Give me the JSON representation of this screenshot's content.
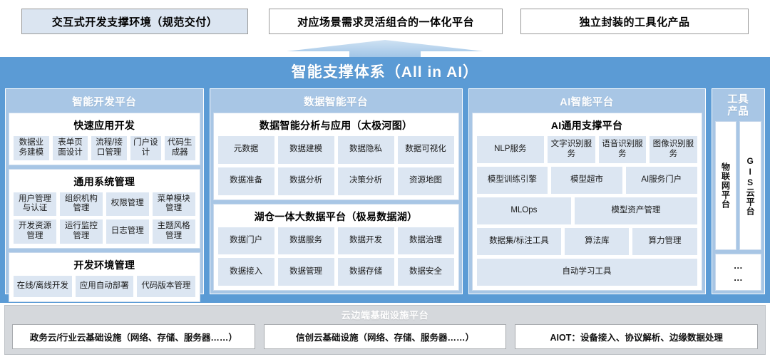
{
  "top_boxes": [
    {
      "label": "交互式开发支撑环境（规范交付）",
      "tinted": true
    },
    {
      "label": "对应场景需求灵活组合的一体化平台",
      "tinted": false
    },
    {
      "label": "独立封装的工具化产品",
      "tinted": false
    }
  ],
  "arrow": {
    "name": "up-arrow-connector",
    "color": "#a8cbe8"
  },
  "main": {
    "title": "智能支撑体系（All in AI）",
    "background_color": "#5b9bd5",
    "panels": [
      {
        "id": "dev",
        "title": "智能开发平台",
        "groups": [
          {
            "title": "快速应用开发",
            "rows": [
              [
                "数据业务建模",
                "表单页面设计",
                "流程/接口管理",
                "门户设计",
                "代码生成器"
              ]
            ]
          },
          {
            "title": "通用系统管理",
            "rows": [
              [
                "用户管理与认证",
                "组织机构管理",
                "权限管理",
                "菜单模块管理"
              ],
              [
                "开发资源管理",
                "运行监控管理",
                "日志管理",
                "主题风格管理"
              ]
            ]
          },
          {
            "title": "开发环境管理",
            "rows": [
              [
                "在线/离线开发",
                "应用自动部署",
                "代码版本管理"
              ]
            ]
          }
        ]
      },
      {
        "id": "data",
        "title": "数据智能平台",
        "groups": [
          {
            "title": "数据智能分析与应用（太极河图）",
            "rows": [
              [
                "元数据",
                "数据建模",
                "数据隐私",
                "数据可视化"
              ],
              [
                "数据准备",
                "数据分析",
                "决策分析",
                "资源地图"
              ]
            ]
          },
          {
            "title": "湖仓一体大数据平台（极易数据湖）",
            "rows": [
              [
                "数据门户",
                "数据服务",
                "数据开发",
                "数据治理"
              ],
              [
                "数据接入",
                "数据管理",
                "数据存储",
                "数据安全"
              ]
            ]
          }
        ]
      },
      {
        "id": "ai",
        "title": "AI智能平台",
        "groups": [
          {
            "title": "AI通用支撑平台",
            "rows": [
              [
                "NLP服务",
                "文字识别服务",
                "语音识别服务",
                "图像识别服务"
              ],
              [
                "模型训练引擎",
                "模型超市",
                "AI服务门户"
              ],
              [
                "MLOps",
                "模型资产管理"
              ],
              [
                "数据集/标注工具",
                "算法库",
                "算力管理"
              ],
              [
                "自动学习工具"
              ]
            ]
          }
        ]
      }
    ],
    "tools_panel": {
      "title_line1": "工具",
      "title_line2": "产品",
      "items": [
        "物联网平台",
        "GIS云平台"
      ],
      "more": "……"
    }
  },
  "bottom": {
    "title": "云边端基础设施平台",
    "boxes": [
      "政务云/行业云基础设施（网络、存储、服务器……）",
      "信创云基础设施（网络、存储、服务器……）",
      "AIOT：设备接入、协议解析、边缘数据处理"
    ]
  }
}
